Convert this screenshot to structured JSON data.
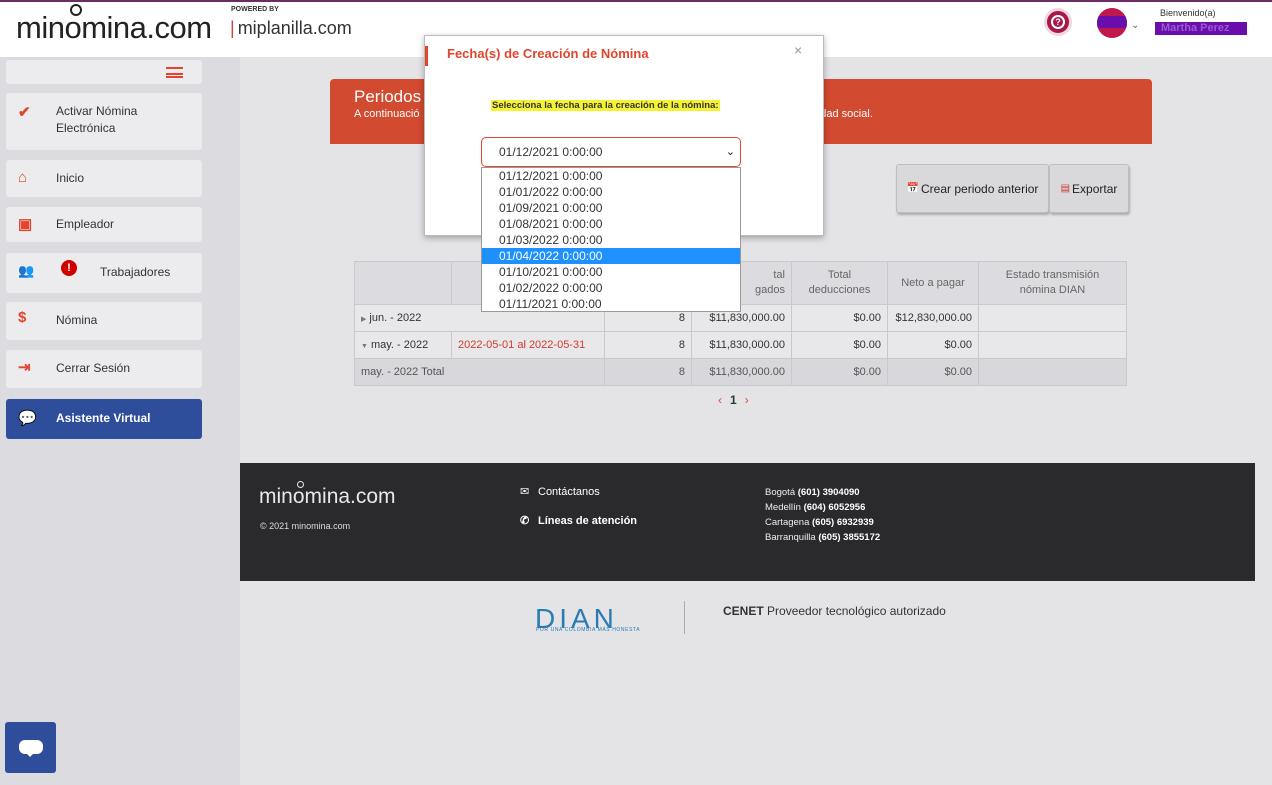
{
  "header": {
    "logo_text": "minomina.com",
    "powered_by": "POWERED BY",
    "partner": "miplanilla.com",
    "welcome": "Bienvenido(a)",
    "user_name": "Martha Perez"
  },
  "sidebar": {
    "items": [
      {
        "label": "Activar Nómina Electrónica"
      },
      {
        "label": "Inicio"
      },
      {
        "label": "Empleador"
      },
      {
        "label": "Trabajadores"
      },
      {
        "label": "Nómina"
      },
      {
        "label": "Cerrar Sesión"
      },
      {
        "label": "Asistente Virtual"
      }
    ]
  },
  "banner": {
    "title": "Periodos A",
    "description_start": "A continuació",
    "description_end": "uridad social."
  },
  "buttons": {
    "create_previous": "Crear periodo anterior",
    "export": "Exportar"
  },
  "table": {
    "headers": [
      "",
      "",
      "",
      "Total\ndevengados",
      "Total\ndeducciones",
      "Neto a pagar",
      "Estado transmisión\nnómina DIAN"
    ],
    "header_partial": "tal\ngados",
    "rows": [
      {
        "period": "jun. - 2022",
        "range": "",
        "count": "8",
        "accrued": "$11,830,000.00",
        "deductions": "$0.00",
        "net": "$12,830,000.00",
        "status": ""
      },
      {
        "period": "may. - 2022",
        "range": "2022-05-01 al 2022-05-31",
        "count": "8",
        "accrued": "$11,830,000.00",
        "deductions": "$0.00",
        "net": "$0.00",
        "status": ""
      }
    ],
    "total_row": {
      "label": "may. - 2022 Total",
      "count": "8",
      "accrued": "$11,830,000.00",
      "deductions": "$0.00",
      "net": "$0.00"
    }
  },
  "pager": {
    "current": "1"
  },
  "footer": {
    "logo_text": "minomina.com",
    "copyright": "© 2021 minomina.com",
    "contact": "Contáctanos",
    "lines": "Líneas de atención",
    "phones": [
      {
        "city": "Bogotá",
        "number": "(601) 3904090"
      },
      {
        "city": "Medellín",
        "number": "(604) 6052956"
      },
      {
        "city": "Cartagena",
        "number": "(605) 6932939"
      },
      {
        "city": "Barranquilla",
        "number": "(605) 3855172"
      }
    ]
  },
  "dian": {
    "logo": "DIAN",
    "tagline": "POR UNA COLOMBIA MÁS HONESTA",
    "provider_bold": "CENET",
    "provider_text": "Proveedor tecnológico autorizado"
  },
  "modal": {
    "title": "Fecha(s) de Creación de Nómina",
    "close": "×",
    "prompt": "Selecciona la fecha para la creación de la nómina:",
    "selected": "01/12/2021 0:00:00",
    "options": [
      "01/12/2021 0:00:00",
      "01/01/2022 0:00:00",
      "01/09/2021 0:00:00",
      "01/08/2021 0:00:00",
      "01/03/2022 0:00:00",
      "01/04/2022 0:00:00",
      "01/10/2021 0:00:00",
      "01/02/2022 0:00:00",
      "01/11/2021 0:00:00"
    ],
    "highlighted_option": "01/04/2022 0:00:00"
  },
  "colors": {
    "accent": "#e1452d",
    "nav_active": "#2e4d9b",
    "banner": "#d24a2f",
    "option_highlight": "#1e90ff"
  }
}
